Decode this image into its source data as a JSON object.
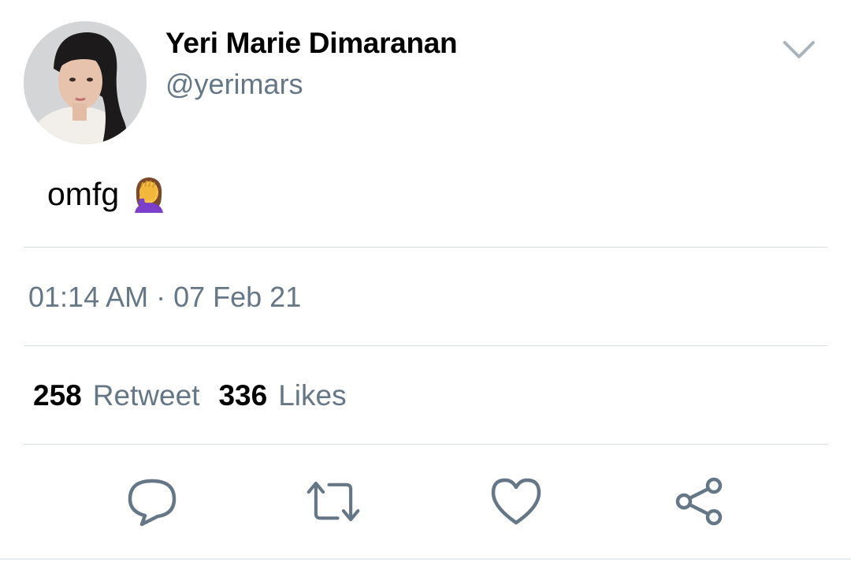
{
  "user": {
    "display_name": "Yeri Marie Dimaranan",
    "handle": "@yerimars"
  },
  "tweet": {
    "text": "omfg",
    "emoji_icon": "woman-facepalming-emoji",
    "timestamp": "01:14 AM · 07 Feb 21"
  },
  "stats": {
    "retweets": {
      "count": "258",
      "label": "Retweet"
    },
    "likes": {
      "count": "336",
      "label": "Likes"
    }
  },
  "actions": [
    {
      "icon": "reply-icon"
    },
    {
      "icon": "retweet-icon"
    },
    {
      "icon": "like-heart-icon"
    },
    {
      "icon": "share-icon"
    }
  ],
  "colors": {
    "text_primary": "#000000",
    "text_secondary": "#657786",
    "icon": "#657786",
    "divider": "#d8dde1"
  }
}
